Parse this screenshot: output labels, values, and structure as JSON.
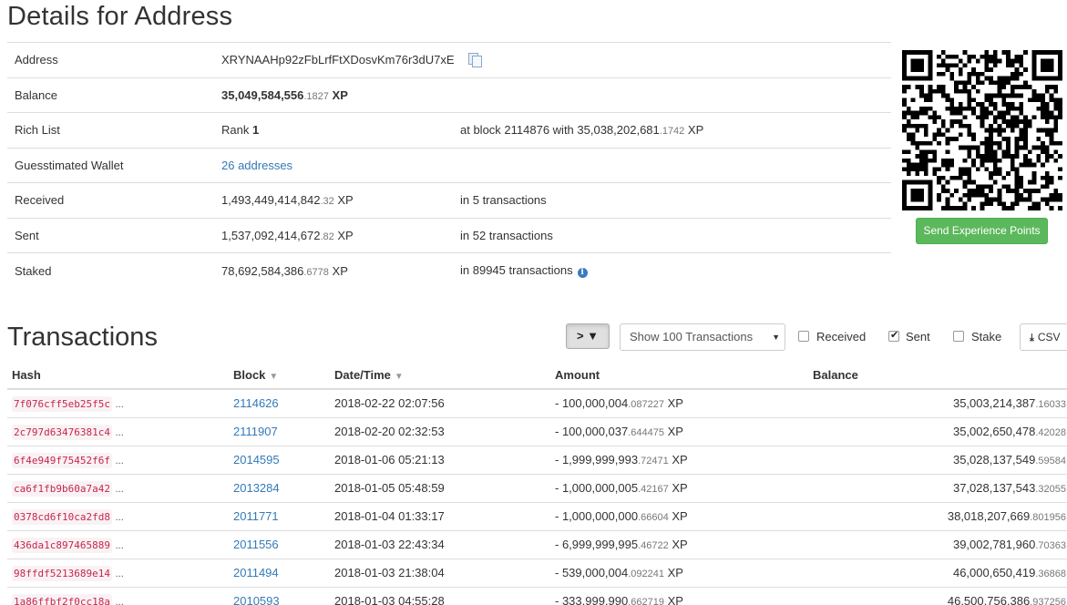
{
  "title": "Details for Address",
  "details": {
    "address": {
      "label": "Address",
      "value": "XRYNAAHp92zFbLrfFtXDosvKm76r3dU7xE"
    },
    "balance": {
      "label": "Balance",
      "int": "35,049,584,556",
      "frac": ".1827",
      "unit": " XP"
    },
    "rich_list": {
      "label": "Rich List",
      "rank_prefix": "Rank ",
      "rank": "1",
      "extra_prefix": "at block 2114876 with 35,038,202,681",
      "extra_frac": ".1742",
      "extra_unit": " XP"
    },
    "wallet": {
      "label": "Guesstimated Wallet",
      "value": "26 addresses"
    },
    "received": {
      "label": "Received",
      "int": "1,493,449,414,842",
      "frac": ".32",
      "unit": " XP",
      "extra": "in 5 transactions"
    },
    "sent": {
      "label": "Sent",
      "int": "1,537,092,414,672",
      "frac": ".82",
      "unit": " XP",
      "extra": "in 52 transactions"
    },
    "staked": {
      "label": "Staked",
      "int": "78,692,584,386",
      "frac": ".6778",
      "unit": " XP",
      "extra": "in 89945 transactions"
    }
  },
  "send_button": "Send Experience Points",
  "transactions": {
    "title": "Transactions",
    "filter_icon": "> ▼",
    "show_select": "Show 100 Transactions",
    "filters": [
      {
        "label": "Received",
        "checked": false
      },
      {
        "label": "Sent",
        "checked": true
      },
      {
        "label": "Stake",
        "checked": false
      }
    ],
    "csv_label": "CSV",
    "columns": [
      "Hash",
      "Block",
      "Date/Time",
      "Amount",
      "Balance"
    ],
    "rows": [
      {
        "hash": "7f076cff5eb25f5c",
        "block": "2114626",
        "date": "2018-02-22 02:07:56",
        "amount_int": "- 100,000,004",
        "amount_frac": ".087227",
        "balance_int": "35,003,214,387",
        "balance_frac": ".16033"
      },
      {
        "hash": "2c797d63476381c4",
        "block": "2111907",
        "date": "2018-02-20 02:32:53",
        "amount_int": "- 100,000,037",
        "amount_frac": ".644475",
        "balance_int": "35,002,650,478",
        "balance_frac": ".42028"
      },
      {
        "hash": "6f4e949f75452f6f",
        "block": "2014595",
        "date": "2018-01-06 05:21:13",
        "amount_int": "- 1,999,999,993",
        "amount_frac": ".72471",
        "balance_int": "35,028,137,549",
        "balance_frac": ".59584"
      },
      {
        "hash": "ca6f1fb9b60a7a42",
        "block": "2013284",
        "date": "2018-01-05 05:48:59",
        "amount_int": "- 1,000,000,005",
        "amount_frac": ".42167",
        "balance_int": "37,028,137,543",
        "balance_frac": ".32055"
      },
      {
        "hash": "0378cd6f10ca2fd8",
        "block": "2011771",
        "date": "2018-01-04 01:33:17",
        "amount_int": "- 1,000,000,000",
        "amount_frac": ".66604",
        "balance_int": "38,018,207,669",
        "balance_frac": ".801956"
      },
      {
        "hash": "436da1c897465889",
        "block": "2011556",
        "date": "2018-01-03 22:43:34",
        "amount_int": "- 6,999,999,995",
        "amount_frac": ".46722",
        "balance_int": "39,002,781,960",
        "balance_frac": ".70363"
      },
      {
        "hash": "98ffdf5213689e14",
        "block": "2011494",
        "date": "2018-01-03 21:38:04",
        "amount_int": "- 539,000,004",
        "amount_frac": ".092241",
        "balance_int": "46,000,650,419",
        "balance_frac": ".36868"
      },
      {
        "hash": "1a86ffbf2f0cc18a",
        "block": "2010593",
        "date": "2018-01-03 04:55:28",
        "amount_int": "- 333,999,990",
        "amount_frac": ".662719",
        "balance_int": "46,500,756,386",
        "balance_frac": ".937256"
      }
    ],
    "unit": " XP",
    "ellipsis": "..."
  },
  "colors": {
    "link": "#337ab7",
    "hash": "#c7254e",
    "button": "#5cb85c"
  }
}
